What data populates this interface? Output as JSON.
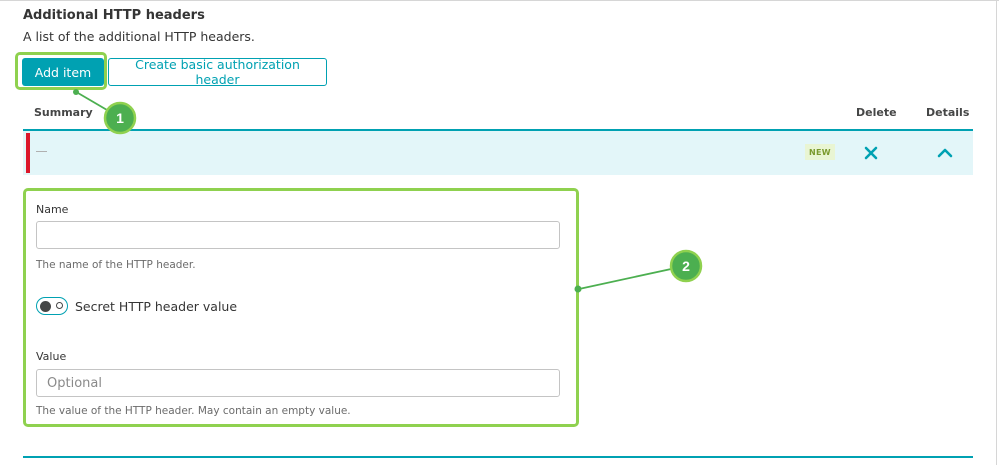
{
  "section": {
    "title": "Additional HTTP headers",
    "description": "A list of the additional HTTP headers."
  },
  "buttons": {
    "add_item": "Add item",
    "basic_auth": "Create basic authorization header"
  },
  "table": {
    "columns": [
      "Summary",
      "Delete",
      "Details"
    ],
    "row": {
      "summary": "—",
      "badge": "NEW"
    }
  },
  "form": {
    "name": {
      "label": "Name",
      "value": "",
      "hint": "The name of the HTTP header."
    },
    "secret_toggle": {
      "label": "Secret HTTP header value",
      "state": "off"
    },
    "value": {
      "label": "Value",
      "placeholder": "Optional",
      "hint": "The value of the HTTP header. May contain an empty value."
    }
  },
  "annotations": [
    "1",
    "2"
  ],
  "colors": {
    "accent": "#00a1b2",
    "highlight": "#8fd14f",
    "annotation_marker": "#4caf50",
    "row_bg": "#e3f6f9",
    "row_marker": "#dc172a"
  }
}
